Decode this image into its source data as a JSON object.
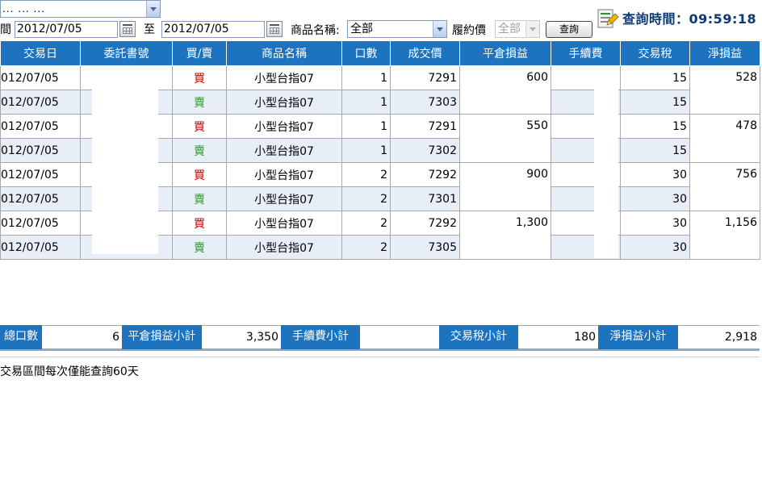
{
  "query": {
    "top_select_value": "... ... ...",
    "range_label": "間",
    "date_from": "2012/07/05",
    "to_label": "至",
    "date_to": "2012/07/05",
    "product_label": "商品名稱:",
    "product_value": "全部",
    "strike_label": "履約價",
    "strike_value": "全部",
    "query_button": "查詢",
    "query_time_label": "查詢時間：",
    "query_time": "09:59:18"
  },
  "table": {
    "headers": [
      "交易日",
      "委託書號",
      "買/賣",
      "商品名稱",
      "口數",
      "成交價",
      "平倉損益",
      "手續費",
      "交易稅",
      "淨損益"
    ],
    "pairs": [
      {
        "buy": {
          "date": "012/07/05",
          "order_no": "",
          "side": "買",
          "product": "小型台指07",
          "qty": "1",
          "price": "7291",
          "fee": "",
          "tax": "15"
        },
        "sell": {
          "date": "012/07/05",
          "order_no": "",
          "side": "賣",
          "product": "小型台指07",
          "qty": "1",
          "price": "7303",
          "fee": "",
          "tax": "15"
        },
        "close_pl": "600",
        "net_pl": "528"
      },
      {
        "buy": {
          "date": "012/07/05",
          "order_no": "",
          "side": "買",
          "product": "小型台指07",
          "qty": "1",
          "price": "7291",
          "fee": "",
          "tax": "15"
        },
        "sell": {
          "date": "012/07/05",
          "order_no": "",
          "side": "賣",
          "product": "小型台指07",
          "qty": "1",
          "price": "7302",
          "fee": "",
          "tax": "15"
        },
        "close_pl": "550",
        "net_pl": "478"
      },
      {
        "buy": {
          "date": "012/07/05",
          "order_no": "",
          "side": "買",
          "product": "小型台指07",
          "qty": "2",
          "price": "7292",
          "fee": "",
          "tax": "30"
        },
        "sell": {
          "date": "012/07/05",
          "order_no": "",
          "side": "賣",
          "product": "小型台指07",
          "qty": "2",
          "price": "7301",
          "fee": "",
          "tax": "30"
        },
        "close_pl": "900",
        "net_pl": "756"
      },
      {
        "buy": {
          "date": "012/07/05",
          "order_no": "",
          "side": "買",
          "product": "小型台指07",
          "qty": "2",
          "price": "7292",
          "fee": "",
          "tax": "30"
        },
        "sell": {
          "date": "012/07/05",
          "order_no": "",
          "side": "賣",
          "product": "小型台指07",
          "qty": "2",
          "price": "7305",
          "fee": "",
          "tax": "30"
        },
        "close_pl": "1,300",
        "net_pl": "1,156"
      }
    ]
  },
  "summary": {
    "total_qty_label": "總口數",
    "total_qty": "6",
    "close_pl_label": "平倉損益小計",
    "close_pl": "3,350",
    "fee_label": "手續費小計",
    "fee": "",
    "tax_label": "交易稅小計",
    "tax": "180",
    "net_label": "淨損益小計",
    "net": "2,918"
  },
  "note": "交易區間每次僅能查詢60天",
  "colors": {
    "header_bg": "#1e73be",
    "alt_row_bg": "#e8eef7",
    "buy_color": "#c00000",
    "sell_color": "#2a9a2a",
    "query_time_color": "#0a3a78"
  }
}
